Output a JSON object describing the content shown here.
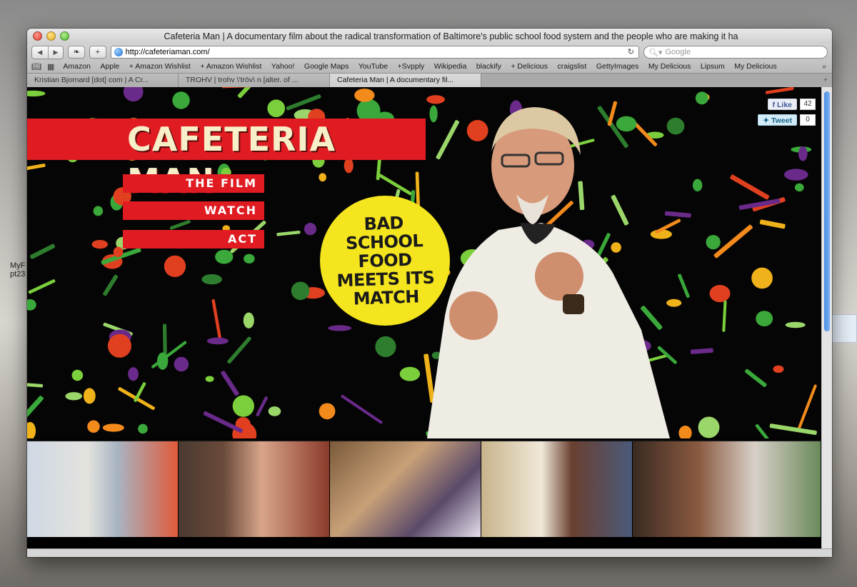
{
  "window": {
    "title": "Cafeteria Man | A documentary film about the radical transformation of Baltimore's public school food system and the people who are making it ha"
  },
  "toolbar": {
    "url": "http://cafeteriaman.com/",
    "search_placeholder": "Google"
  },
  "bookmarks": [
    "Amazon",
    "Apple",
    "+ Amazon Wishlist",
    "+ Amazon Wishlist",
    "Yahoo!",
    "Google Maps",
    "YouTube",
    "+Svpply",
    "Wikipedia",
    "blackify",
    "+ Delicious",
    "craigslist",
    "GettyImages",
    "My Delicious",
    "Lipsum",
    "My Delicious"
  ],
  "tabs": [
    {
      "label": "Kristian Bjornard [dot] com | A Cr...",
      "active": false
    },
    {
      "label": "TROHV | trohv \\'trōv\\ n [alter. of ...",
      "active": false
    },
    {
      "label": "Cafeteria Man | A documentary fil...",
      "active": true
    }
  ],
  "page": {
    "banner": "CAFETERIA MAN",
    "nav": [
      "THE FILM",
      "WATCH",
      "ACT"
    ],
    "tagline": "BAD\nSCHOOL FOOD\nMEETS ITS\nMATCH",
    "social": {
      "like_label": "Like",
      "like_count": "42",
      "tweet_label": "Tweet",
      "tweet_count": "0"
    }
  },
  "desktop": {
    "icon_label": "MyF pt23"
  },
  "colors": {
    "brand_red": "#e01b22",
    "circle_yellow": "#f4e51e",
    "banner_text": "#f7efc8"
  }
}
